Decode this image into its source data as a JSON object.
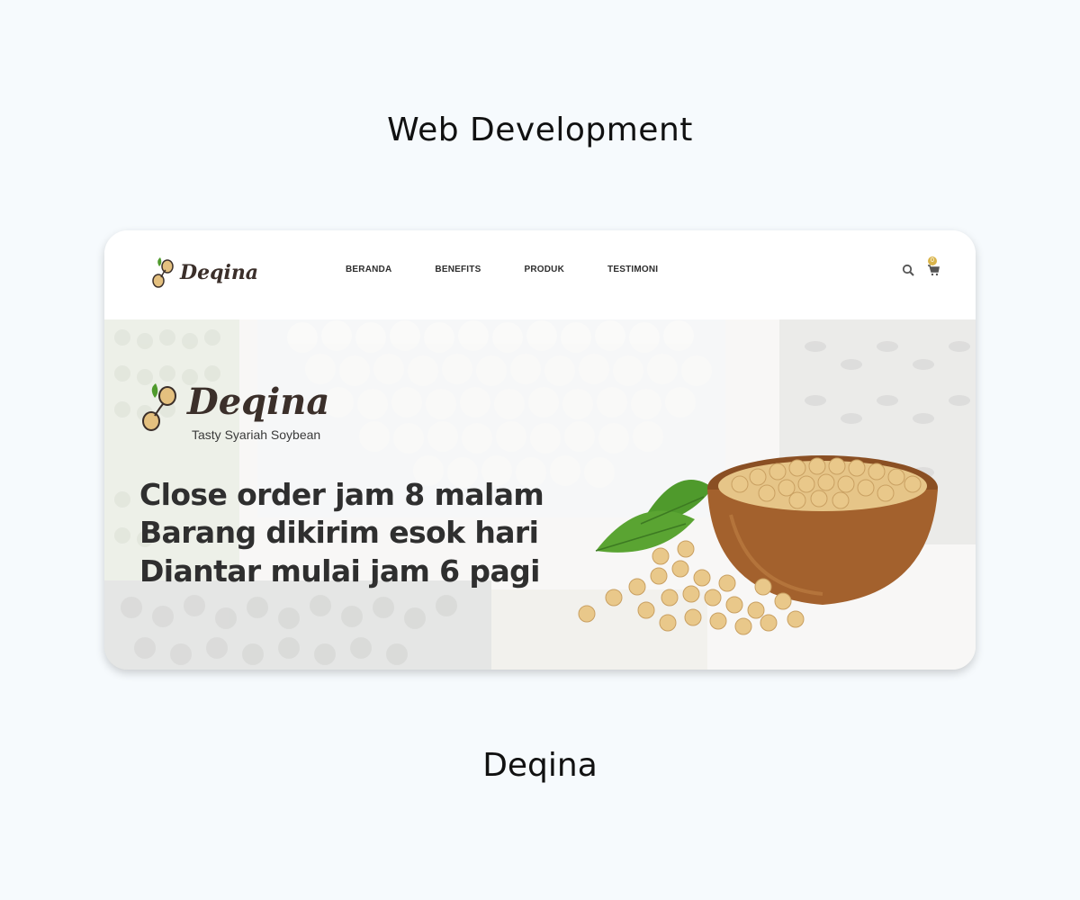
{
  "page": {
    "heading": "Web Development",
    "caption": "Deqina"
  },
  "site": {
    "brand": "Deqina",
    "nav": {
      "items": [
        "BERANDA",
        "BENEFITS",
        "PRODUK",
        "TESTIMONI"
      ],
      "cart_count": "0"
    },
    "hero": {
      "tagline": "Tasty Syariah Soybean",
      "lines": [
        "Close order jam 8 malam",
        "Barang dikirim esok hari",
        "Diantar mulai jam 6 pagi"
      ]
    }
  },
  "colors": {
    "page_bg": "#f6fafd",
    "brand_dark": "#3b2f2a",
    "bean": "#e4c07f",
    "leaf": "#4f9a2c",
    "badge": "#d9b44a"
  }
}
